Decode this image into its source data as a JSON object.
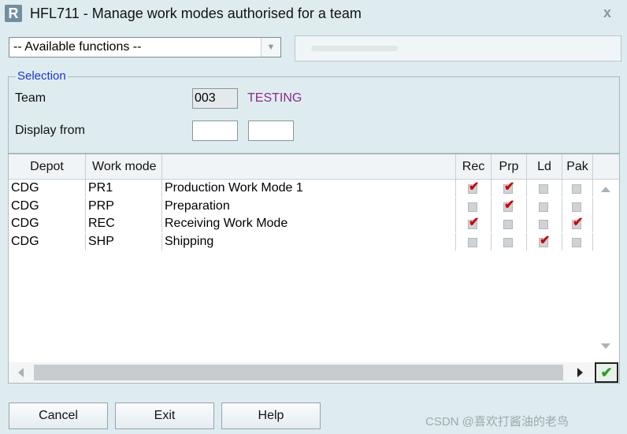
{
  "window": {
    "logo": "R",
    "title": "HFL711 - Manage work modes authorised for a team",
    "close": "x"
  },
  "functions": {
    "selected": "-- Available functions --"
  },
  "selection": {
    "group_label": "Selection",
    "team_label": "Team",
    "team_code": "003",
    "team_name": "TESTING",
    "display_from_label": "Display from",
    "display_from_1": "",
    "display_from_2": ""
  },
  "grid": {
    "columns": [
      "Depot",
      "Work mode",
      "",
      "Rec",
      "Prp",
      "Ld",
      "Pak"
    ],
    "rows": [
      {
        "depot": "CDG",
        "mode": "PR1",
        "desc": "Production Work Mode 1",
        "rec": true,
        "prp": true,
        "ld": false,
        "pak": false
      },
      {
        "depot": "CDG",
        "mode": "PRP",
        "desc": "Preparation",
        "rec": false,
        "prp": true,
        "ld": false,
        "pak": false
      },
      {
        "depot": "CDG",
        "mode": "REC",
        "desc": "Receiving Work Mode",
        "rec": true,
        "prp": false,
        "ld": false,
        "pak": true
      },
      {
        "depot": "CDG",
        "mode": "SHP",
        "desc": "Shipping",
        "rec": false,
        "prp": false,
        "ld": true,
        "pak": false
      }
    ]
  },
  "buttons": {
    "cancel": "Cancel",
    "exit": "Exit",
    "help": "Help"
  },
  "icons": {
    "checkmark": "✔",
    "tick": "✔"
  },
  "watermark": "CSDN @喜欢打酱油的老鸟",
  "colors": {
    "accent": "#1535d8",
    "team_name": "#8b2b8b",
    "check_red": "#d00000"
  }
}
